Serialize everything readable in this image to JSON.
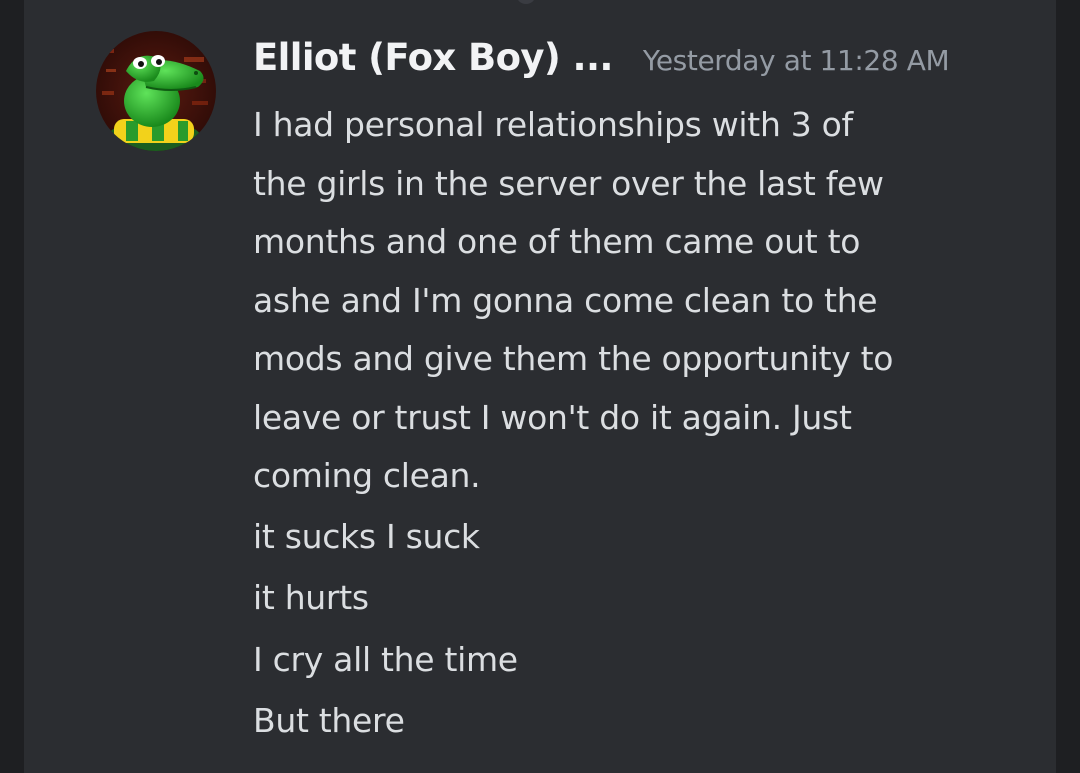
{
  "message": {
    "author": "Elliot (Fox Boy) ...",
    "timestamp": "Yesterday at 11:28 AM",
    "avatar_icon": "crocodile-avatar",
    "paragraph_lines": [
      "I had personal relationships with 3 of",
      "the girls in the server over the last few",
      "months and one of them came out to",
      "ashe and I'm gonna come clean to the",
      "mods and give them the opportunity to",
      "leave or trust I won't do it again. Just",
      "coming clean."
    ],
    "follow_up_lines": [
      "it sucks I suck",
      "it hurts",
      "I cry all the time",
      "But there"
    ]
  },
  "colors": {
    "background": "#1e1f22",
    "panel": "#2b2d31",
    "username": "#f2f3f5",
    "timestamp": "#949ba4",
    "message_text": "#dbdee1"
  }
}
